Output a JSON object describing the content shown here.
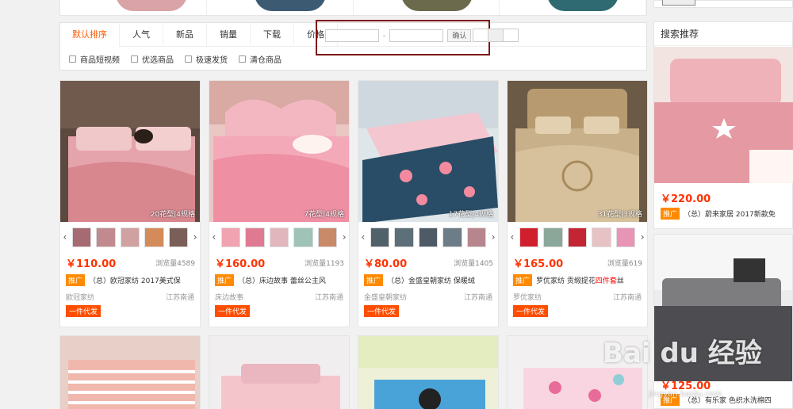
{
  "sort_tabs": [
    "默认排序",
    "人气",
    "新品",
    "销量",
    "下载",
    "价格"
  ],
  "price_filter": {
    "currency": "¥",
    "separator": "-",
    "confirm_label": "确认"
  },
  "check_filters": [
    "商品短视频",
    "优选商品",
    "极速发货",
    "清仓商品"
  ],
  "products": [
    {
      "tag": "20花型|4规格",
      "price": "￥110.00",
      "views": "浏览量4589",
      "promo": "推广",
      "title": "（总）欧冠家纺  2017美式保",
      "title_red": "",
      "shop": "欧冠家纺",
      "location": "江苏南通",
      "dropship": "一件代发"
    },
    {
      "tag": "7花型|4规格",
      "price": "￥160.00",
      "views": "浏览量1193",
      "promo": "推广",
      "title": "（总）床边故事  蕾丝公主风",
      "title_red": "",
      "shop": "床边故事",
      "location": "江苏南通",
      "dropship": "一件代发"
    },
    {
      "tag": "17花型|4规格",
      "price": "￥80.00",
      "views": "浏览量1405",
      "promo": "推广",
      "title": "（总）金盛皇朝家纺  保暖绒",
      "title_red": "",
      "shop": "金盛皇朝家纺",
      "location": "江苏南通",
      "dropship": "一件代发"
    },
    {
      "tag": "31花型|3规格",
      "price": "￥165.00",
      "views": "浏览量619",
      "promo": "推广",
      "title": "罗优家纺  贡缎提花",
      "title_red": "四件套",
      "title_tail": "丝",
      "shop": "罗优家纺",
      "location": "江苏南通",
      "dropship": "一件代发"
    }
  ],
  "sidebar": {
    "heading": "搜索推荐",
    "items": [
      {
        "price": "￥220.00",
        "promo": "推广",
        "title": "（总）蔚来家居  2017新款免"
      },
      {
        "price": "￥125.00",
        "promo": "推广",
        "title": "（总）有乐家  色织水洗棉四"
      }
    ]
  },
  "watermark": {
    "logo": "Bai du 经验",
    "url": "jingyan.baidu.com"
  },
  "colors": {
    "accent": "#ff5a00",
    "price": "#ff3300",
    "promo": "#ff8a00",
    "highlight_box": "#7f1616"
  }
}
